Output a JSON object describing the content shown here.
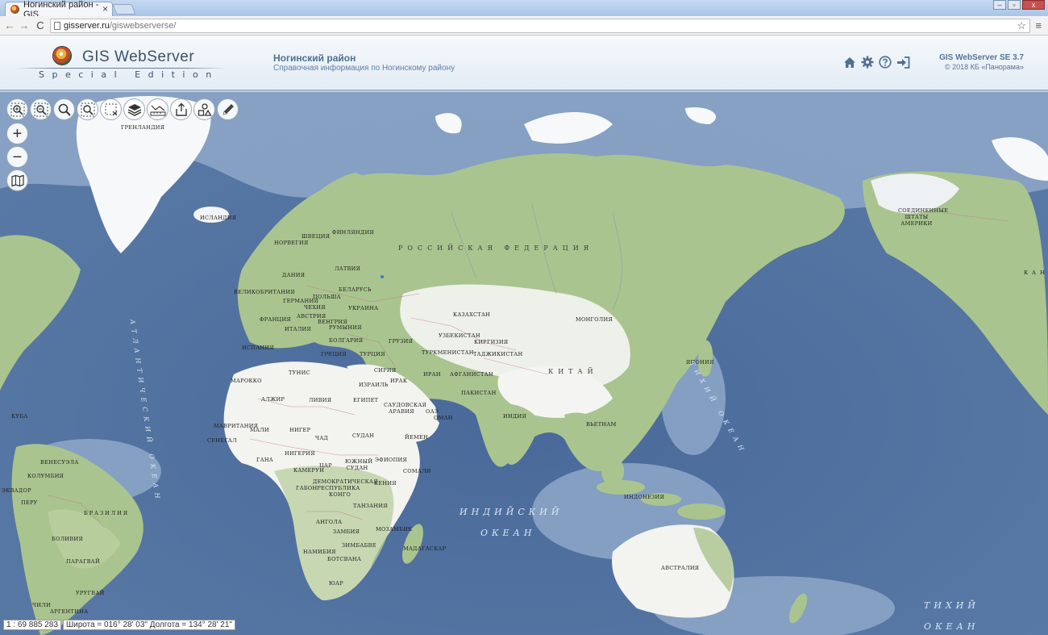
{
  "browser": {
    "tab_title": "Ногинский район - GIS",
    "tab_close": "×",
    "url_host": "gisserver.ru",
    "url_path": "/giswebserverse/",
    "back": "←",
    "forward": "→",
    "reload": "C",
    "star": "☆",
    "menu": "≡",
    "win_min": "–",
    "win_max": "▫",
    "win_close": "x"
  },
  "header": {
    "logo_title": "GIS WebServer",
    "logo_subtitle": "Special Edition",
    "project_title": "Ногинский район",
    "project_subtitle": "Справочная информация по Ногинскому району",
    "version_title": "GIS WebServer SE 3.7",
    "version_copy": "© 2018 КБ «Панорама»",
    "icons": [
      "home-icon",
      "gear-icon",
      "help-icon",
      "login-icon"
    ]
  },
  "map": {
    "colors": {
      "ocean_deep": "#4f6f9c",
      "ocean_shelf": "#8fa8c8",
      "land": "#a9c48f",
      "desert": "#f3f3ef",
      "ice": "#f7f9fb"
    },
    "tools": [
      "zoom-in-area-icon",
      "zoom-out-area-icon",
      "search-icon",
      "search-area-icon",
      "select-area-icon",
      "layers-icon",
      "measure-icon",
      "export-icon",
      "objects-icon",
      "edit-icon"
    ],
    "zoom_in": "+",
    "zoom_out": "−",
    "labels": {
      "greenland": "ГРЕНЛАНДИЯ",
      "iceland": "ИСЛАНДИЯ",
      "norway": "НОРВЕГИЯ",
      "sweden": "ШВЕЦИЯ",
      "finland": "ФИНЛЯНДИЯ",
      "latvia": "ЛАТВИЯ",
      "denmark": "ДАНИЯ",
      "belarus": "БЕЛАРУСЬ",
      "uk": "ВЕЛИКОБРИТАНИЯ",
      "poland": "ПОЛЬША",
      "germany": "ГЕРМАНИЯ",
      "czech": "ЧЕХИЯ",
      "ukraine": "УКРАИНА",
      "austria": "АВСТРИЯ",
      "hungary": "ВЕНГРИЯ",
      "france": "ФРАНЦИЯ",
      "romania": "РУМЫНИЯ",
      "italy": "ИТАЛИЯ",
      "bulgaria": "БОЛГАРИЯ",
      "spain": "ИСПАНИЯ",
      "greece": "ГРЕЦИЯ",
      "turkey": "ТУРЦИЯ",
      "georgia": "ГРУЗИЯ",
      "russia": "РОССИЙСКАЯ ФЕДЕРАЦИЯ",
      "kazakhstan": "КАЗАХСТАН",
      "uzbekistan": "УЗБЕКИСТАН",
      "kyrgyzstan": "КИРГИЗИЯ",
      "turkmenistan": "ТУРКМЕНИСТАН",
      "tajikistan": "ТАДЖИКИСТАН",
      "mongolia": "МОНГОЛИЯ",
      "china": "КИТАЙ",
      "japan": "ЯПОНИЯ",
      "iran": "ИРАН",
      "afghanistan": "АФГАНИСТАН",
      "pakistan": "ПАКИСТАН",
      "india": "ИНДИЯ",
      "vietnam": "ВЬЕТНАМ",
      "indonesia": "ИНДОНЕЗИЯ",
      "australia": "АВСТРАЛИЯ",
      "usa": "СОЕДИНЕННЫЕ ШТАТЫ АМЕРИКИ",
      "canada": "КАН",
      "tunisia": "ТУНИС",
      "morocco": "МАРОККО",
      "algeria": "АЛЖИР",
      "libya": "ЛИВИЯ",
      "egypt": "ЕГИПЕТ",
      "israel": "ИЗРАИЛЬ",
      "syria": "СИРИЯ",
      "iraq": "ИРАК",
      "saudi": "САУДОВСКАЯ АРАВИЯ",
      "oae": "ОАЭ",
      "oman": "ОМАН",
      "yemen": "ЙЕМЕН",
      "mauritania": "МАВРИТАНИЯ",
      "mali": "МАЛИ",
      "niger": "НИГЕР",
      "chad": "ЧАД",
      "sudan": "СУДАН",
      "senegal": "СЕНЕГАЛ",
      "nigeria": "НИГЕРИЯ",
      "ghana": "ГАНА",
      "cameroon": "КАМЕРУН",
      "car": "ЦАР",
      "south_sudan": "ЮЖНЫЙ СУДАН",
      "ethiopia": "ЭФИОПИЯ",
      "somalia": "СОМАЛИ",
      "drc": "ДЕМОКРАТИЧЕСКАЯ РЕСПУБЛИКА",
      "congo": "КОНГО",
      "gabon": "ГАБОН",
      "kenya": "КЕНИЯ",
      "tanzania": "ТАНЗАНИЯ",
      "angola": "АНГОЛА",
      "zambia": "ЗАМБИЯ",
      "mozambique": "МОЗАМБИК",
      "zimbabwe": "ЗИМБАБВЕ",
      "namibia": "НАМИБИЯ",
      "botswana": "БОТСВАНА",
      "madagascar": "МАДАГАСКАР",
      "sar": "ЮАР",
      "venezuela": "ВЕНЕСУЭЛА",
      "colombia": "КОЛУМБИЯ",
      "ecuador": "ЭКВАДОР",
      "peru": "ПЕРУ",
      "brazil": "БРАЗИЛИЯ",
      "bolivia": "БОЛИВИЯ",
      "paraguay": "ПАРАГВАЙ",
      "chile": "ЧИЛИ",
      "uruguay": "УРУГВАЙ",
      "argentina": "АРГЕНТИНА",
      "cuba": "КУБА",
      "indian_ocean_1": "ИНДИЙСКИЙ",
      "indian_ocean_2": "ОКЕАН",
      "pacific_1": "ТИХИЙ",
      "pacific_2": "ОКЕАН",
      "atlantic": "АТЛАНТИЧЕСКИЙ ОКЕАН",
      "pacific_vert": "ТИХИЙ ОКЕАН"
    },
    "scale": "1 : 69 885 283",
    "coords": "Широта = 016° 28' 03\"  Долгота = 134° 28' 21\""
  }
}
